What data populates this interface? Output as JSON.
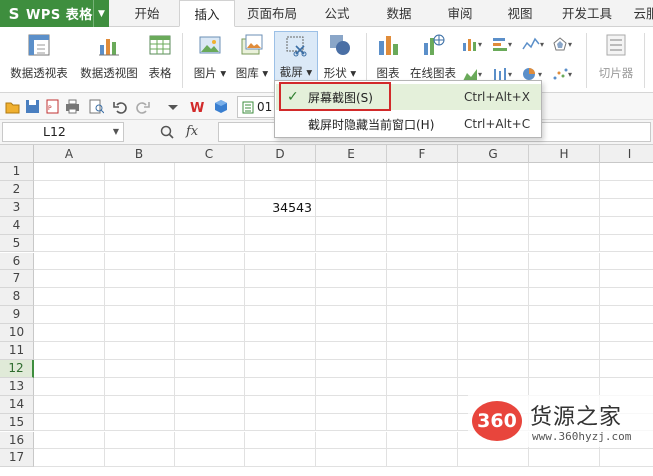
{
  "app": {
    "name": "WPS 表格",
    "logo": "S"
  },
  "tabs": [
    "开始",
    "插入",
    "页面布局",
    "公式",
    "数据",
    "审阅",
    "视图",
    "开发工具",
    "云服"
  ],
  "active_tab": "插入",
  "ribbon": {
    "pivot_table": "数据透视表",
    "pivot_chart": "数据透视图",
    "table": "表格",
    "picture": "图片",
    "gallery": "图库",
    "screenshot": "截屏",
    "shapes": "形状",
    "chart": "图表",
    "online_chart": "在线图表",
    "slicer": "切片器"
  },
  "quick_access": {
    "file_tab": "01"
  },
  "formula_bar": {
    "name_box": "L12",
    "fx": "fx",
    "value": ""
  },
  "columns": [
    "A",
    "B",
    "C",
    "D",
    "E",
    "F",
    "G",
    "H",
    "I"
  ],
  "rows": [
    "1",
    "2",
    "3",
    "4",
    "5",
    "6",
    "7",
    "8",
    "9",
    "10",
    "11",
    "12",
    "13",
    "14",
    "15",
    "16",
    "17"
  ],
  "selected_row": "12",
  "cells": {
    "D3": "34543"
  },
  "menu": {
    "item1": {
      "label": "屏幕截图(S)",
      "shortcut": "Ctrl+Alt+X",
      "checked": "✓"
    },
    "item2": {
      "label": "截屏时隐藏当前窗口(H)",
      "shortcut": "Ctrl+Alt+C"
    }
  },
  "watermark": {
    "logo": "360",
    "title": "货源之家",
    "url": "www.360hyzj.com"
  },
  "colors": {
    "brand_green": "#3e8e3e",
    "highlight_red": "#d22a2a",
    "menu_hover": "#e4f0da"
  }
}
